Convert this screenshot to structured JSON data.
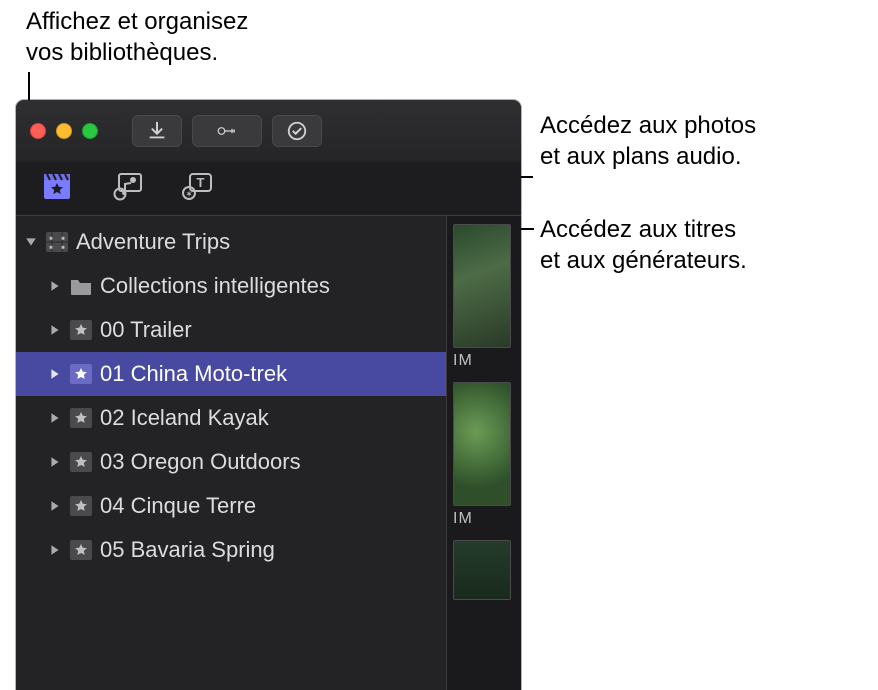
{
  "callouts": {
    "libraries": "Affichez et organisez\nvos bibliothèques.",
    "photos_audio": "Accédez aux photos\net aux plans audio.",
    "titles_generators": "Accédez aux titres\net aux générateurs."
  },
  "toolbar": {
    "import_label": "Import",
    "keyword_label": "Keyword",
    "tasks_label": "Tasks"
  },
  "tabs": {
    "libraries": "Libraries",
    "photos_audio": "Photos/Audio",
    "titles_generators": "Titles/Generators"
  },
  "library": {
    "name": "Adventure Trips",
    "items": [
      {
        "type": "smart",
        "label": "Collections intelligentes"
      },
      {
        "type": "event",
        "label": "00 Trailer"
      },
      {
        "type": "event",
        "label": "01 China Moto-trek",
        "selected": true
      },
      {
        "type": "event",
        "label": "02 Iceland Kayak"
      },
      {
        "type": "event",
        "label": "03 Oregon Outdoors"
      },
      {
        "type": "event",
        "label": "04 Cinque Terre"
      },
      {
        "type": "event",
        "label": "05 Bavaria Spring"
      }
    ]
  },
  "thumbnails": {
    "label1": "IM",
    "label2": "IM"
  }
}
